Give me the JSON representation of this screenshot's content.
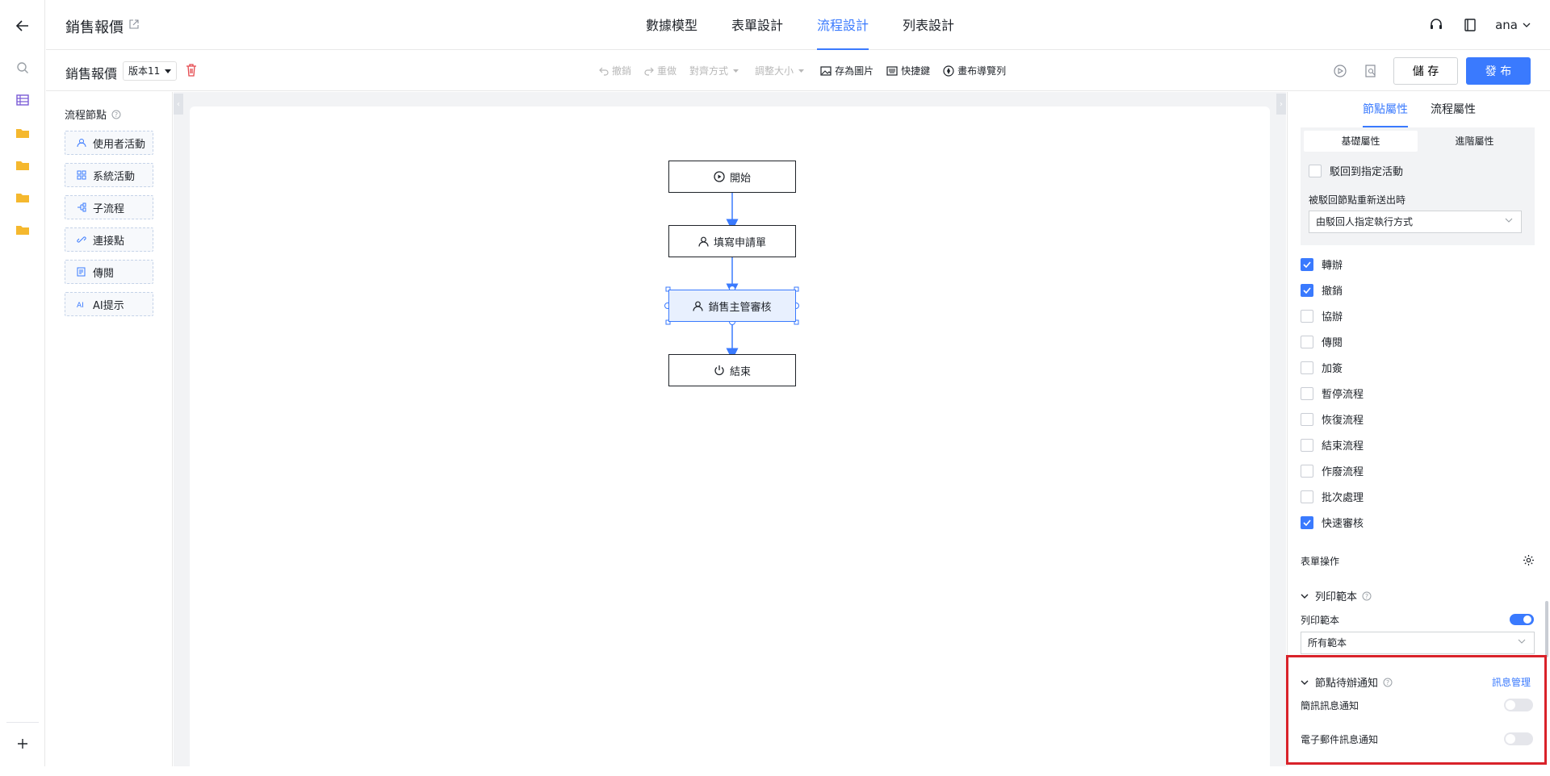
{
  "header": {
    "app_title": "銷售報價",
    "tabs": [
      "數據模型",
      "表單設計",
      "流程設計",
      "列表設計"
    ],
    "active_tab_index": 2,
    "user": "ana"
  },
  "toolbar": {
    "doc_title": "銷售報價",
    "version": "版本11",
    "undo": "撤銷",
    "redo": "重做",
    "align": "對齊方式",
    "resize": "調整大小",
    "save_image": "存為圖片",
    "shortcuts": "快捷鍵",
    "canvas_nav": "畫布導覽列",
    "save": "儲 存",
    "publish": "發 布"
  },
  "nodes_panel": {
    "title": "流程節點",
    "items": [
      "使用者活動",
      "系統活動",
      "子流程",
      "連接點",
      "傳閱",
      "AI提示"
    ]
  },
  "flow": {
    "nodes": [
      "開始",
      "填寫申請單",
      "銷售主管審核",
      "結束"
    ],
    "selected_index": 2
  },
  "props": {
    "tabs": [
      "節點屬性",
      "流程屬性"
    ],
    "subtabs": [
      "基礎屬性",
      "進階屬性"
    ],
    "reject_to_activity": "駁回到指定活動",
    "resubmit_label": "被駁回節點重新送出時",
    "resubmit_value": "由駁回人指定執行方式",
    "checks": [
      {
        "label": "轉辦",
        "checked": true
      },
      {
        "label": "撤銷",
        "checked": true
      },
      {
        "label": "協辦",
        "checked": false
      },
      {
        "label": "傳閱",
        "checked": false
      },
      {
        "label": "加簽",
        "checked": false
      },
      {
        "label": "暫停流程",
        "checked": false
      },
      {
        "label": "恢復流程",
        "checked": false
      },
      {
        "label": "結束流程",
        "checked": false
      },
      {
        "label": "作廢流程",
        "checked": false
      },
      {
        "label": "批次處理",
        "checked": false
      },
      {
        "label": "快速審核",
        "checked": true
      }
    ],
    "form_ops": "表單操作",
    "print_section": "列印範本",
    "print_toggle_label": "列印範本",
    "print_toggle_on": true,
    "print_select": "所有範本",
    "notify_section": "節點待辦通知",
    "notify_link": "訊息管理",
    "sms_label": "簡訊訊息通知",
    "sms_on": false,
    "email_label": "電子郵件訊息通知",
    "email_on": false
  }
}
